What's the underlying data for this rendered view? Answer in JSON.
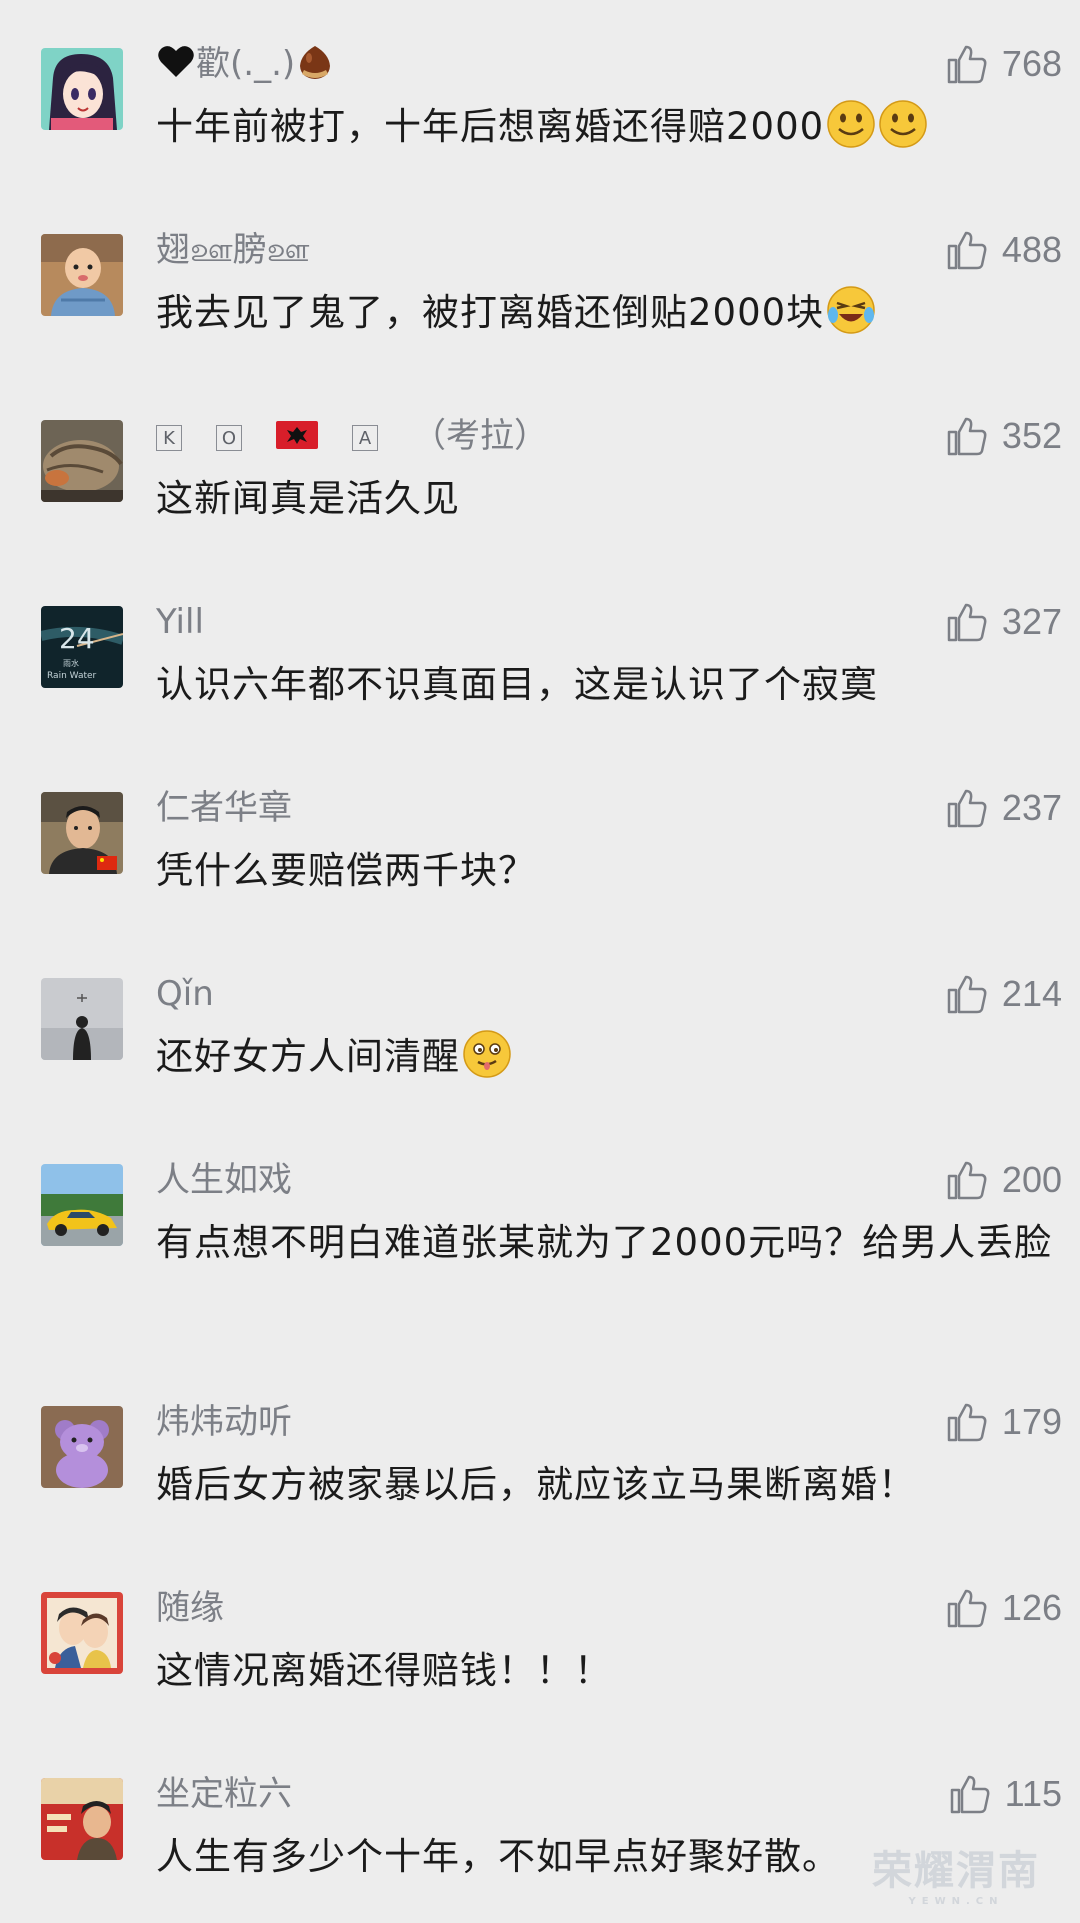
{
  "comments": [
    {
      "user": "歡(._.)",
      "text": "十年前被打，十年后想离婚还得赔2000",
      "likes": "768",
      "avatar": "anime-girl"
    },
    {
      "user": "翅ஊ膀ஊ",
      "text": "我去见了鬼了，被打离婚还倒贴2000块",
      "likes": "488",
      "avatar": "baby"
    },
    {
      "user_parts": [
        "K",
        "O",
        "A"
      ],
      "user_suffix": "（考拉）",
      "text": "这新闻真是活久见",
      "likes": "352",
      "avatar": "cat"
    },
    {
      "user": "Yill",
      "text": "认识六年都不识真面目，这是认识了个寂寞",
      "likes": "327",
      "avatar": "rain-water",
      "avatar_text": {
        "num": "24",
        "cn": "雨水",
        "en": "Rain Water"
      }
    },
    {
      "user": "仁者华章",
      "text": "凭什么要赔偿两千块？",
      "likes": "237",
      "avatar": "man-flag"
    },
    {
      "user": "Qǐn",
      "text": "还好女方人间清醒",
      "likes": "214",
      "avatar": "silhouette"
    },
    {
      "user": "人生如戏",
      "text": "有点想不明白难道张某就为了2000元吗？给男人丢脸",
      "likes": "200",
      "avatar": "yellow-car"
    },
    {
      "user": "炜炜动听",
      "text": "婚后女方被家暴以后，就应该立马果断离婚！",
      "likes": "179",
      "avatar": "teddy-bear"
    },
    {
      "user": "随缘",
      "text": "这情况离婚还得赔钱！！！",
      "likes": "126",
      "avatar": "anime-couple"
    },
    {
      "user": "坐定粒六",
      "text": "人生有多少个十年，不如早点好聚好散。",
      "likes": "115",
      "avatar": "red-poster"
    }
  ],
  "watermark": {
    "main": "荣耀渭南",
    "sub": "YEWN.CN"
  },
  "colors": {
    "background": "#ededed",
    "name": "#7c7f86",
    "text": "#1b1b1b"
  }
}
